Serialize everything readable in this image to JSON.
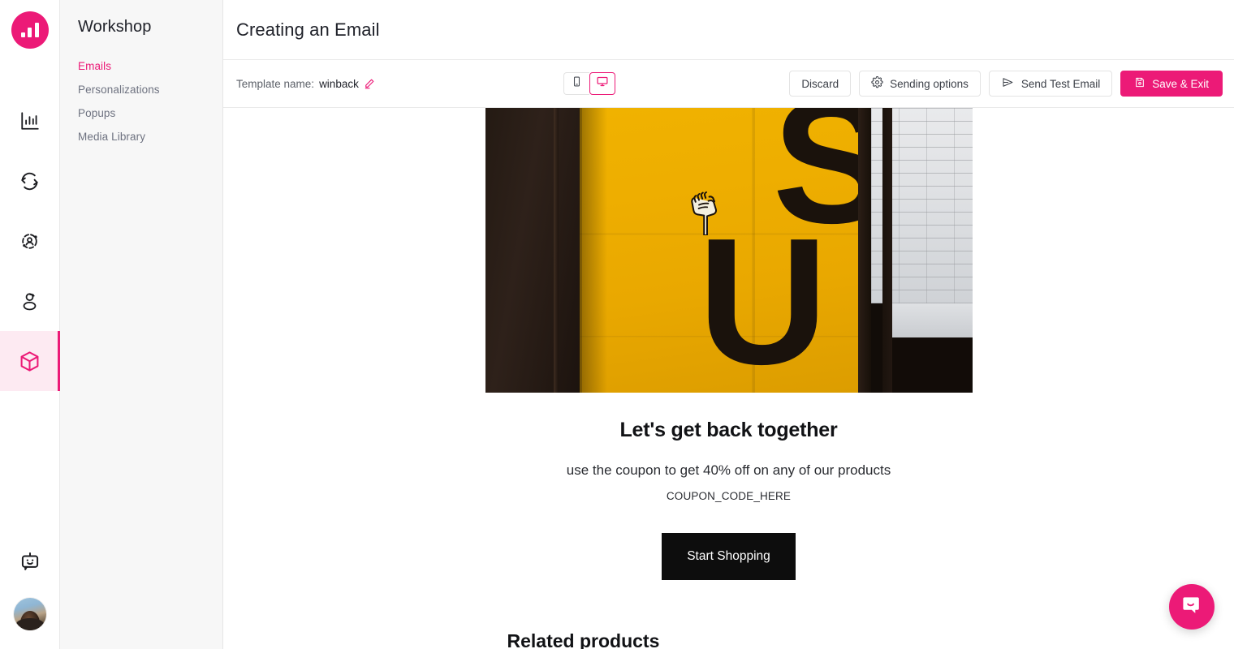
{
  "brand": {
    "accent": "#ec1a77",
    "accent_soft": "#fdeaf2",
    "logo_icon": "bar-chart-logo-icon"
  },
  "icon_rail": {
    "items": [
      {
        "name": "analytics",
        "icon": "bar-chart-icon",
        "active": false
      },
      {
        "name": "automations",
        "icon": "sync-refresh-icon",
        "active": false
      },
      {
        "name": "audiences",
        "icon": "audience-network-icon",
        "active": false
      },
      {
        "name": "personas",
        "icon": "persona-user-icon",
        "active": false
      },
      {
        "name": "workshop",
        "icon": "cube-box-icon",
        "active": true
      }
    ],
    "bottom": [
      {
        "name": "assistant",
        "icon": "robot-icon"
      },
      {
        "name": "account-avatar",
        "icon": "user-avatar-photo"
      }
    ]
  },
  "sidebar": {
    "title": "Workshop",
    "items": [
      {
        "label": "Emails",
        "active": true
      },
      {
        "label": "Personalizations",
        "active": false
      },
      {
        "label": "Popups",
        "active": false
      },
      {
        "label": "Media Library",
        "active": false
      }
    ]
  },
  "header": {
    "title": "Creating an Email"
  },
  "toolbar": {
    "template_label": "Template name:",
    "template_value": "winback",
    "edit_icon": "pencil-edit-icon",
    "device_toggle": {
      "mobile": {
        "label": "Mobile",
        "icon": "mobile-phone-icon",
        "active": false
      },
      "desktop": {
        "label": "Desktop",
        "icon": "desktop-monitor-icon",
        "active": true
      }
    },
    "discard_label": "Discard",
    "sending_options_label": "Sending options",
    "sending_options_icon": "gear-icon",
    "send_test_label": "Send Test Email",
    "send_test_icon": "send-paper-plane-icon",
    "save_exit_label": "Save & Exit",
    "save_exit_icon": "save-floppy-disk-icon"
  },
  "email": {
    "hero_alt": "Yellow wall with US painted in black and clasped hands illustration",
    "heading": "Let's get back together",
    "subheading": "use the coupon to get 40% off on any of our products",
    "coupon_code": "COUPON_CODE_HERE",
    "cta_label": "Start Shopping",
    "related_heading": "Related products",
    "hero_letters": {
      "s": "S",
      "u": "U"
    }
  },
  "intercom": {
    "icon": "chat-bubble-smile-icon",
    "label": "Open Intercom Messenger"
  }
}
